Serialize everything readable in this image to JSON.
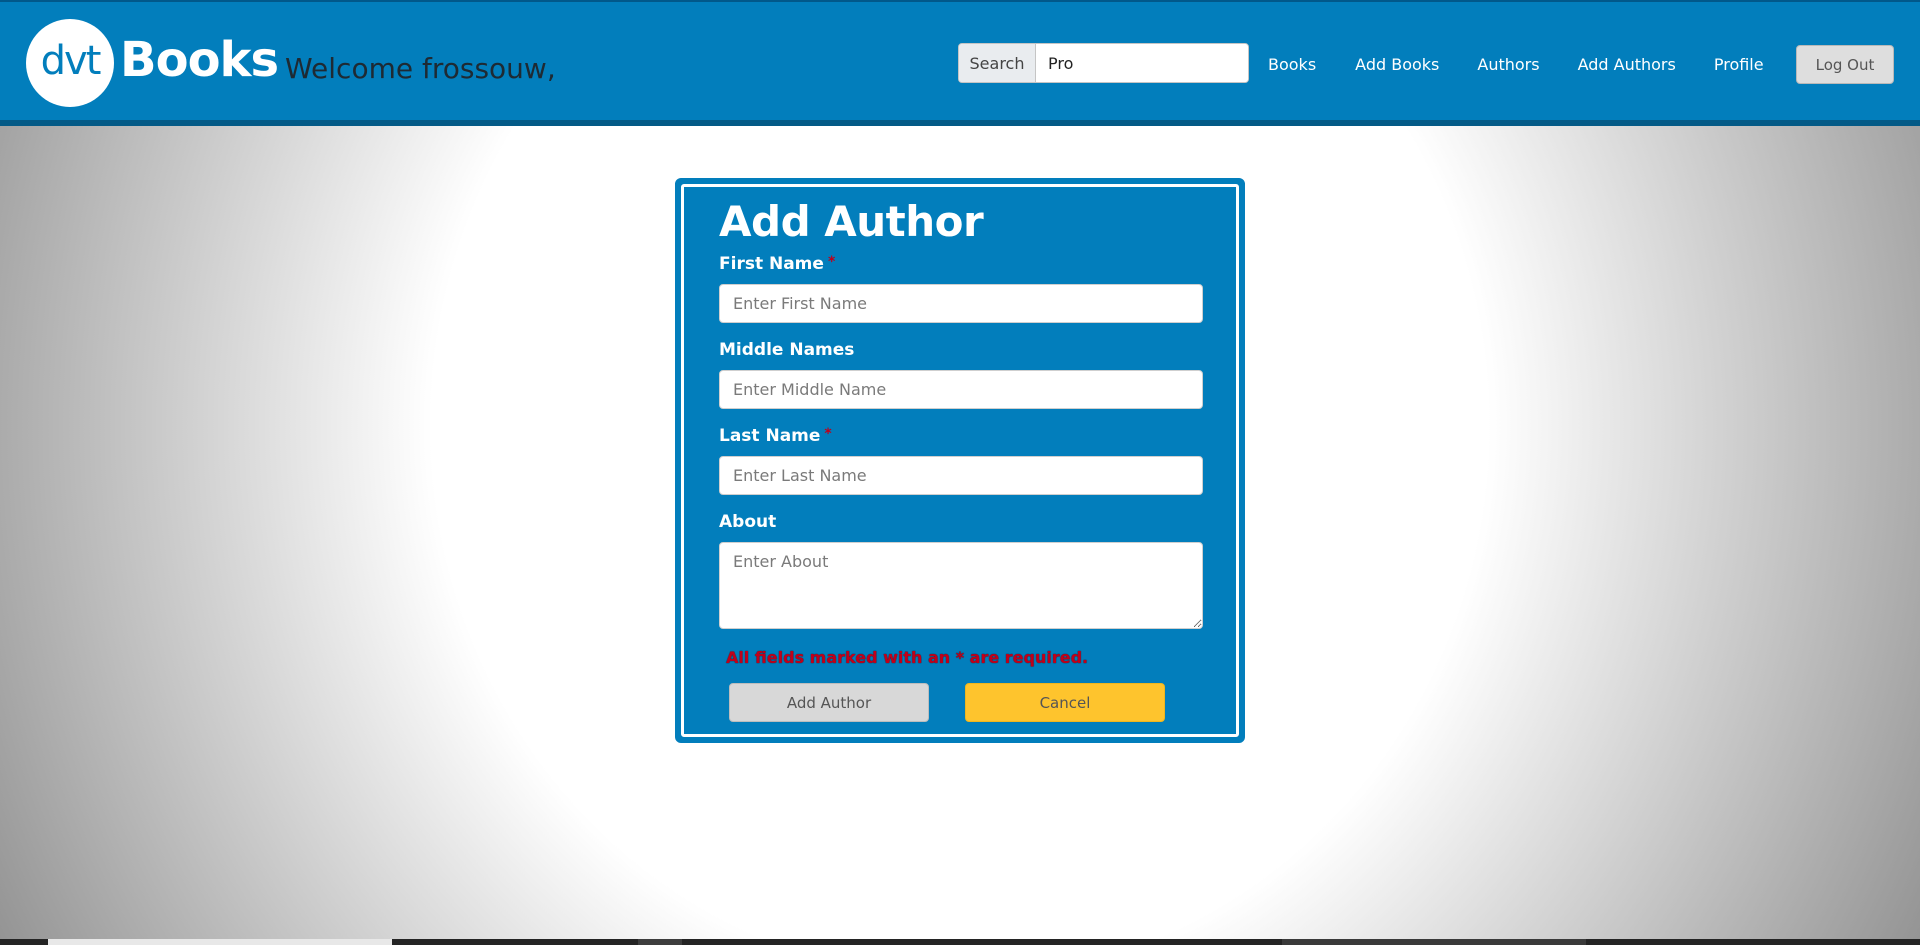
{
  "header": {
    "logo_mark": "dvt",
    "logo_text": "Books",
    "welcome": "Welcome frossouw,",
    "search": {
      "label": "Search",
      "value": "Pro"
    },
    "nav": [
      "Books",
      "Add Books",
      "Authors",
      "Add Authors",
      "Profile"
    ],
    "logout_label": "Log Out"
  },
  "form": {
    "title": "Add Author",
    "required_marker": "*",
    "fields": {
      "first_name": {
        "label": "First Name",
        "placeholder": "Enter First Name",
        "required": true
      },
      "middle_names": {
        "label": "Middle Names",
        "placeholder": "Enter Middle Name",
        "required": false
      },
      "last_name": {
        "label": "Last Name",
        "placeholder": "Enter Last Name",
        "required": true
      },
      "about": {
        "label": "About",
        "placeholder": "Enter About",
        "required": false
      }
    },
    "required_note": "All fields marked with an * are required.",
    "submit_label": "Add Author",
    "cancel_label": "Cancel"
  },
  "colors": {
    "brand_blue": "#027ebc",
    "header_border": "#035a87",
    "cancel_yellow": "#fec42d",
    "required_red": "#c0001a"
  }
}
